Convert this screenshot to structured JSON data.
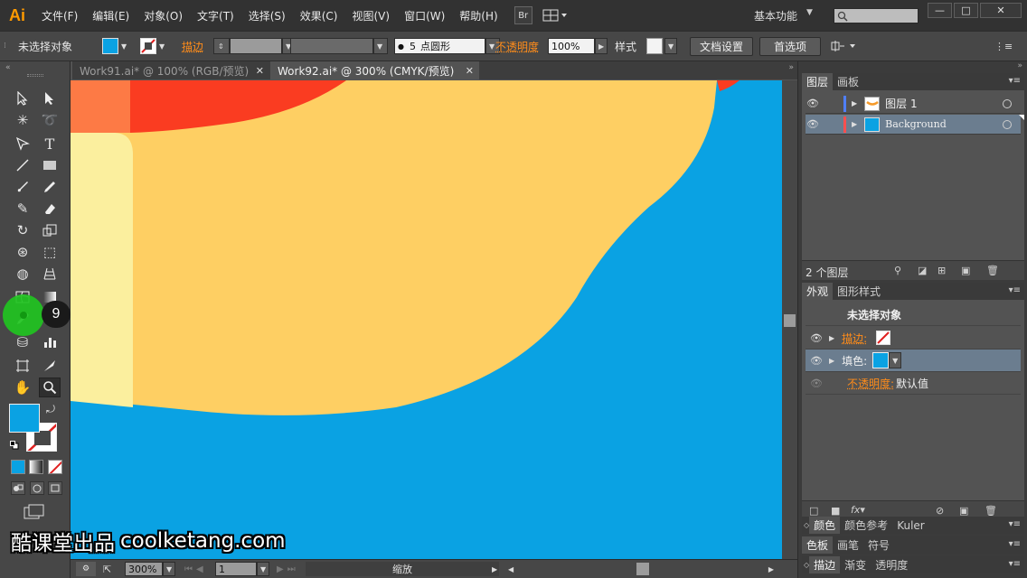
{
  "app": {
    "logo": "Ai",
    "menus": [
      "文件(F)",
      "编辑(E)",
      "对象(O)",
      "文字(T)",
      "选择(S)",
      "效果(C)",
      "视图(V)",
      "窗口(W)",
      "帮助(H)"
    ],
    "bridge_label": "Br",
    "workspace": "基本功能",
    "window_controls": [
      "—",
      "□",
      "✕"
    ]
  },
  "control": {
    "selection_label": "未选择对象",
    "stroke_label": "描边",
    "brush_size": "5",
    "brush_shape": "点圆形",
    "opacity_label": "不透明度",
    "opacity_value": "100%",
    "style_label": "样式",
    "doc_setup_button": "文档设置",
    "prefs_button": "首选项"
  },
  "tabs": [
    {
      "title": "Work91.ai* @ 100% (RGB/预览)",
      "active": false
    },
    {
      "title": "Work92.ai* @ 300% (CMYK/预览)",
      "active": true
    }
  ],
  "tools": {
    "tooltip_number": "9",
    "fill_color": "#0aa2e3"
  },
  "canvas": {
    "background_color": "#0aa2e3",
    "yellow_color": "#fecf63",
    "pale_color": "#fbef9e",
    "red_color": "#fa3c21",
    "orange_color": "#fd7a45"
  },
  "status": {
    "zoom": "300%",
    "artboard": "1",
    "tool_name": "缩放"
  },
  "watermark": {
    "cn": "酷课堂出品",
    "url": "coolketang.com"
  },
  "layers_panel": {
    "tabs": [
      "图层",
      "画板"
    ],
    "layers": [
      {
        "name": "图层 1",
        "color": "#4f7fff"
      },
      {
        "name": "Background",
        "color": "#ff4f4f"
      }
    ],
    "count": "2 个图层"
  },
  "appearance_panel": {
    "tabs": [
      "外观",
      "图形样式"
    ],
    "title": "未选择对象",
    "rows": [
      {
        "label": "描边:"
      },
      {
        "label": "填色:"
      },
      {
        "label": "不透明度:",
        "value": "默认值"
      }
    ]
  },
  "bottom_panels": [
    {
      "tabs": [
        "颜色",
        "颜色参考",
        "Kuler"
      ]
    },
    {
      "tabs": [
        "色板",
        "画笔",
        "符号"
      ]
    },
    {
      "tabs": [
        "描边",
        "渐变",
        "透明度"
      ]
    }
  ]
}
